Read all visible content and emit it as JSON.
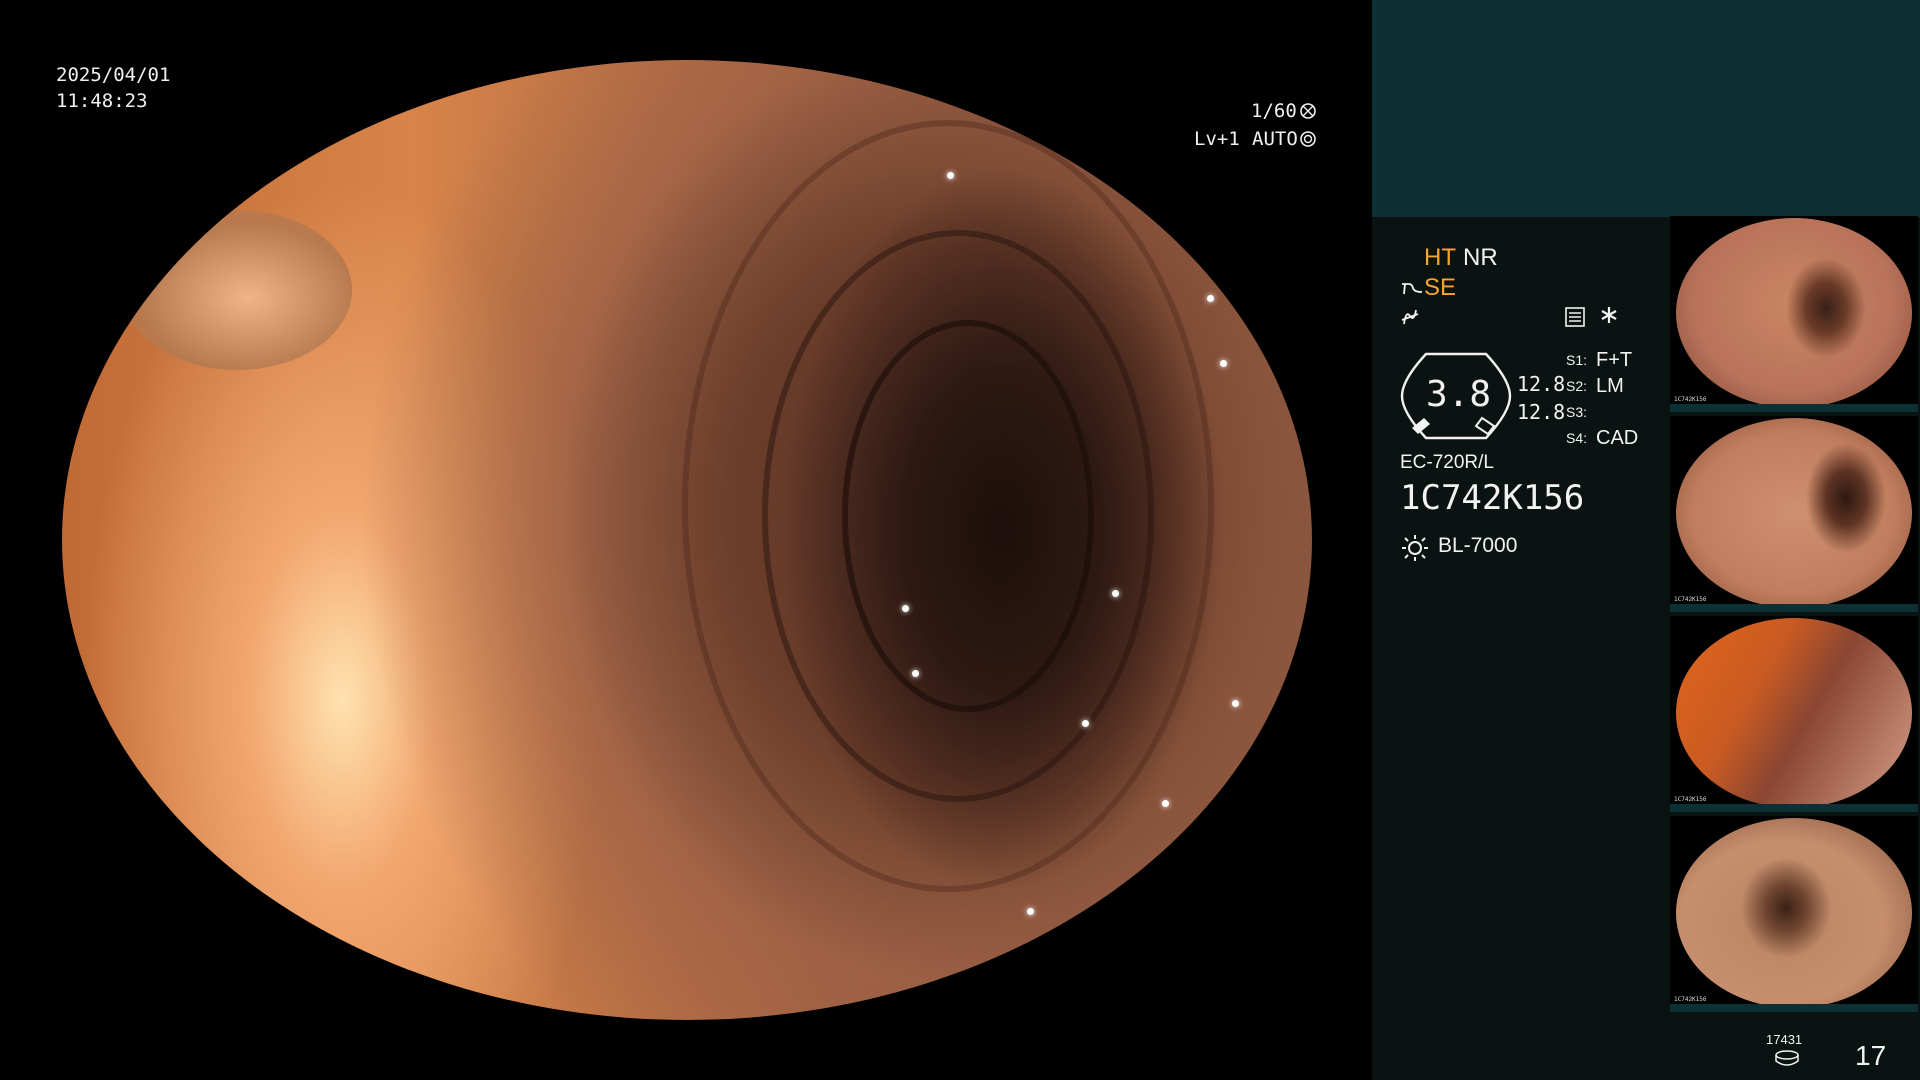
{
  "overlay": {
    "date": "2025/04/01",
    "time": "11:48:23",
    "shutter": "1/60",
    "level": "Lv+1",
    "mode": "AUTO"
  },
  "settings": {
    "ht": "HT",
    "nr": "NR",
    "se": "SE",
    "zoom_value": "3.8",
    "num1": "12.8",
    "num2": "12.8",
    "s1_label": "S1:",
    "s1_value": "F+T",
    "s2_label": "S2:",
    "s2_value": "LM",
    "s3_label": "S3:",
    "s3_value": "",
    "s4_label": "S4:",
    "s4_value": "CAD",
    "scope_model": "EC-720R/L",
    "scope_serial": "1C742K156",
    "light_source": "BL-7000"
  },
  "footer": {
    "counter_small": "17431",
    "counter_large": "17"
  },
  "thumbnails": [
    {
      "serial": "1C742K156"
    },
    {
      "serial": "1C742K156"
    },
    {
      "serial": "1C742K156"
    },
    {
      "serial": "1C742K156"
    }
  ],
  "colors": {
    "panel_teal": "#0e3034",
    "panel_dark": "#0b1212",
    "amber": "#f6a530"
  }
}
